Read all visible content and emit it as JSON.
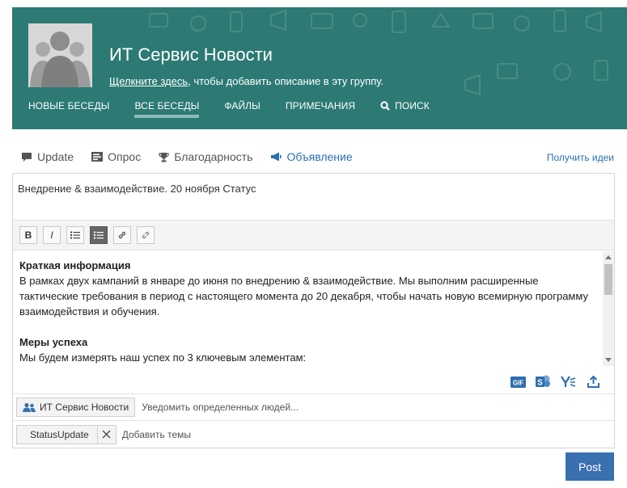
{
  "group": {
    "title": "ИТ Сервис Новости",
    "description_link": "Щелкните здесь",
    "description_rest": ", чтобы добавить описание в эту группу.",
    "nav": [
      {
        "label": "НОВЫЕ БЕСЕДЫ"
      },
      {
        "label": "ВСЕ БЕСЕДЫ",
        "active": true
      },
      {
        "label": "ФАЙЛЫ"
      },
      {
        "label": "ПРИМЕЧАНИЯ"
      },
      {
        "label": "ПОИСК"
      }
    ]
  },
  "publisher": {
    "tabs": [
      {
        "label": "Update",
        "icon": "speech-bubble-icon"
      },
      {
        "label": "Опрос",
        "icon": "poll-icon"
      },
      {
        "label": "Благодарность",
        "icon": "trophy-icon"
      },
      {
        "label": "Объявление",
        "icon": "megaphone-icon",
        "active": true
      }
    ],
    "ideas_link": "Получить идеи"
  },
  "composer": {
    "title_value": "Внедрение & взаимодействие. 20 ноября Статус",
    "toolbar": [
      {
        "name": "bold",
        "label": "B"
      },
      {
        "name": "italic",
        "label": "I"
      },
      {
        "name": "bullet-list"
      },
      {
        "name": "numbered-list",
        "active": true
      },
      {
        "name": "link"
      },
      {
        "name": "unlink"
      }
    ],
    "body": {
      "heading1": "Краткая информация",
      "paragraph1": "В рамках двух кампаний в январе до июня по внедрению & взаимодействие. Мы выполним расширенные тактические требования в период с настоящего момента до 20 декабря, чтобы начать новую всемирную программу взаимодействия и обучения.",
      "heading2": "Меры успеха",
      "paragraph2": "Мы будем измерять наш успех по 3 ключевым элементам:"
    },
    "attachments": [
      "gif-icon",
      "sharepoint-icon",
      "yammer-icon",
      "upload-icon"
    ],
    "gif_label": "GIF",
    "notify": {
      "group_pill": "ИТ Сервис Новости",
      "placeholder": "Уведомить определенных людей..."
    },
    "topics": {
      "tag": "StatusUpdate",
      "placeholder": "Добавить темы"
    },
    "post_label": "Post"
  },
  "colors": {
    "header_bg": "#2c7a73",
    "accent": "#2a6fb3",
    "post_button": "#3a6fb0"
  }
}
